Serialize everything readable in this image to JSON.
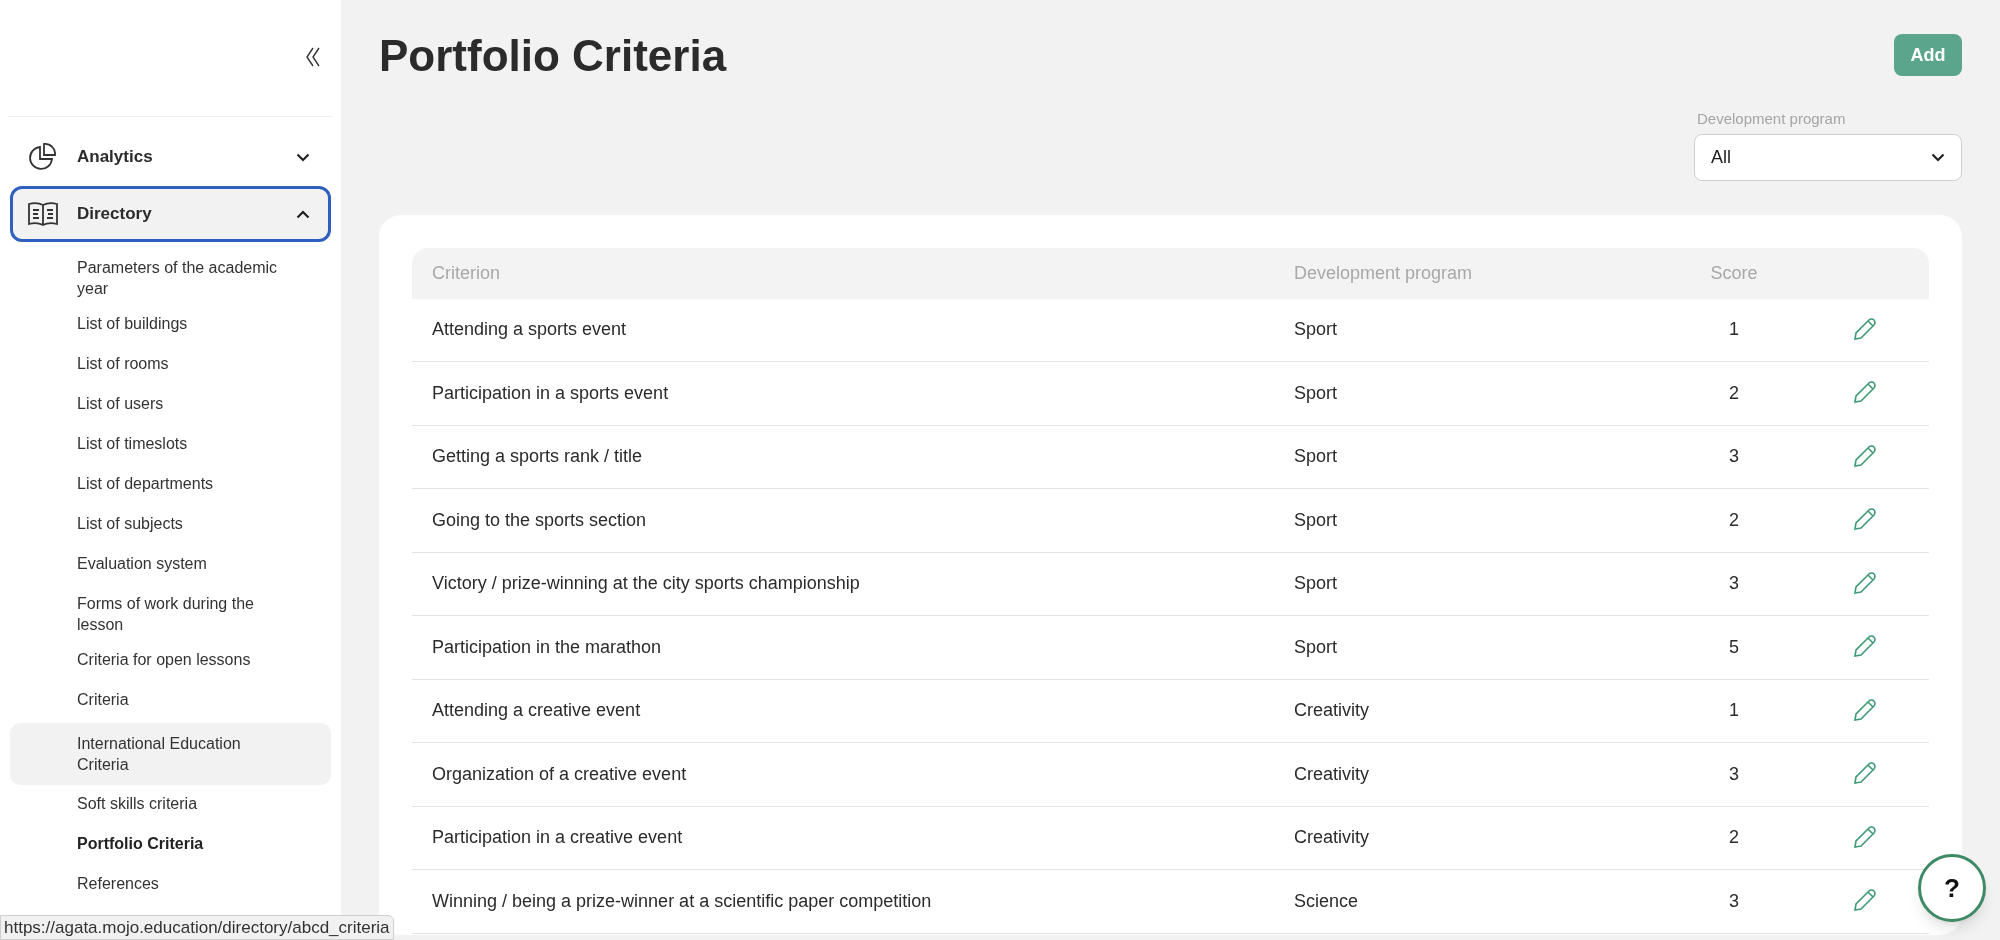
{
  "sidebar": {
    "nav": [
      {
        "label": "Analytics",
        "kind": "pie",
        "expanded": false,
        "focused": false
      },
      {
        "label": "Directory",
        "kind": "book",
        "expanded": true,
        "focused": true,
        "children": [
          {
            "label": "Parameters of the academic year",
            "selected": false,
            "highlighted": false
          },
          {
            "label": "List of buildings",
            "selected": false,
            "highlighted": false
          },
          {
            "label": "List of rooms",
            "selected": false,
            "highlighted": false
          },
          {
            "label": "List of users",
            "selected": false,
            "highlighted": false
          },
          {
            "label": "List of timeslots",
            "selected": false,
            "highlighted": false
          },
          {
            "label": "List of departments",
            "selected": false,
            "highlighted": false
          },
          {
            "label": "List of subjects",
            "selected": false,
            "highlighted": false
          },
          {
            "label": "Evaluation system",
            "selected": false,
            "highlighted": false
          },
          {
            "label": "Forms of work during the lesson",
            "selected": false,
            "highlighted": false
          },
          {
            "label": "Criteria for open lessons",
            "selected": false,
            "highlighted": false
          },
          {
            "label": "Criteria",
            "selected": false,
            "highlighted": false
          },
          {
            "label": "International Education Criteria",
            "selected": false,
            "highlighted": true
          },
          {
            "label": "Soft skills criteria",
            "selected": false,
            "highlighted": false
          },
          {
            "label": "Portfolio Criteria",
            "selected": true,
            "highlighted": false
          },
          {
            "label": "References",
            "selected": false,
            "highlighted": false
          }
        ]
      }
    ]
  },
  "page": {
    "title": "Portfolio Criteria",
    "add_button": "Add",
    "filter": {
      "label": "Development program",
      "value": "All"
    }
  },
  "table": {
    "columns": [
      "Criterion",
      "Development program",
      "Score"
    ],
    "rows": [
      {
        "criterion": "Attending a sports event",
        "program": "Sport",
        "score": "1"
      },
      {
        "criterion": "Participation in a sports event",
        "program": "Sport",
        "score": "2"
      },
      {
        "criterion": "Getting a sports rank / title",
        "program": "Sport",
        "score": "3"
      },
      {
        "criterion": "Going to the sports section",
        "program": "Sport",
        "score": "2"
      },
      {
        "criterion": "Victory / prize-winning at the city sports championship",
        "program": "Sport",
        "score": "3"
      },
      {
        "criterion": "Participation in the marathon",
        "program": "Sport",
        "score": "5"
      },
      {
        "criterion": "Attending a creative event",
        "program": "Creativity",
        "score": "1"
      },
      {
        "criterion": "Organization of a creative event",
        "program": "Creativity",
        "score": "3"
      },
      {
        "criterion": "Participation in a creative event",
        "program": "Creativity",
        "score": "2"
      },
      {
        "criterion": "Winning / being a prize-winner at a scientific paper competition",
        "program": "Science",
        "score": "3"
      }
    ]
  },
  "help_button": "?",
  "status_url": "https://agata.mojo.education/directory/abcd_criteria"
}
